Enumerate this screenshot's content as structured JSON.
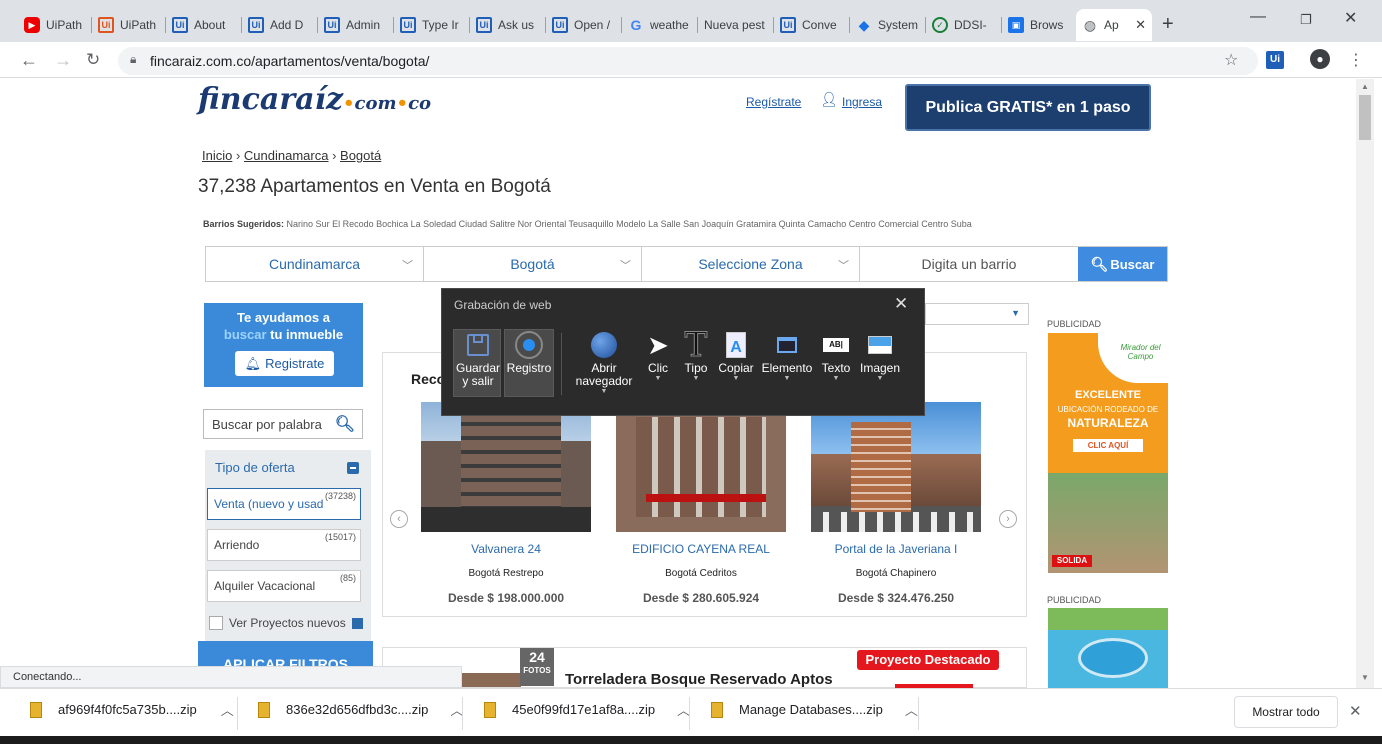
{
  "browser": {
    "tabs": [
      {
        "icon": "youtube-icon",
        "label": "UiPath"
      },
      {
        "icon": "uipath-icon",
        "label": "UiPath"
      },
      {
        "icon": "uipath-icon",
        "label": "About"
      },
      {
        "icon": "uipath-icon",
        "label": "Add D"
      },
      {
        "icon": "uipath-icon",
        "label": "Admin"
      },
      {
        "icon": "uipath-icon",
        "label": "Type Ir"
      },
      {
        "icon": "uipath-icon",
        "label": "Ask us"
      },
      {
        "icon": "uipath-icon",
        "label": "Open /"
      },
      {
        "icon": "google-icon",
        "label": "weathe"
      },
      {
        "icon": "",
        "label": "Nueva pest"
      },
      {
        "icon": "uipath-icon",
        "label": "Conve"
      },
      {
        "icon": "diamond-icon",
        "label": "System"
      },
      {
        "icon": "check-circle-icon",
        "label": "DDSI-"
      },
      {
        "icon": "box-icon",
        "label": "Brows"
      },
      {
        "icon": "globe-icon",
        "label": "Ap"
      }
    ],
    "url": "fincaraiz.com.co/apartamentos/venta/bogota/",
    "status": "Conectando..."
  },
  "header": {
    "logo_main": "fincaraíz",
    "logo_dom": "com",
    "logo_tld": "co",
    "register_link": "Regístrate",
    "login_link": "Ingresa",
    "publish_button": "Publica GRATIS* en 1 paso"
  },
  "breadcrumb": [
    "Inicio",
    "Cundinamarca",
    "Bogotá"
  ],
  "page_title": "37,238 Apartamentos en Venta en Bogotá",
  "barrios": {
    "label": "Barrios Sugeridos:",
    "items": "Narino Sur   El Recodo   Bochica   La Soledad   Ciudad Salitre Nor Oriental Teusaquillo   Modelo   La Salle   San Joaquín   Gratamira   Quinta Camacho   Centro Comercial Centro Suba"
  },
  "filters": {
    "department": "Cundinamarca",
    "city": "Bogotá",
    "zone": "Seleccione Zona",
    "neighborhood_placeholder": "Digita un barrio",
    "search_button": "Buscar"
  },
  "sidebar": {
    "help_line1": "Te ayudamos a",
    "help_highlight": "buscar",
    "help_line2": " tu inmueble",
    "register_button": "Registrate",
    "keyword_placeholder": "Buscar por palabra",
    "offer_header": "Tipo de oferta",
    "offers": [
      {
        "label": "Venta (nuevo y usad",
        "count": "(37238)"
      },
      {
        "label": "Arriendo",
        "count": "(15017)"
      },
      {
        "label": "Alquiler Vacacional",
        "count": "(85)"
      }
    ],
    "projects_checkbox": "Ver Proyectos nuevos",
    "apply_button": "APLICAR FILTROS"
  },
  "carousel": {
    "title": "Reco",
    "cards": [
      {
        "name": "Valvanera 24",
        "location": "Bogotá Restrepo",
        "price": "Desde $ 198.000.000"
      },
      {
        "name": "EDIFICIO CAYENA REAL",
        "location": "Bogotá Cedritos",
        "price": "Desde $ 280.605.924"
      },
      {
        "name": "Portal de la Javeriana I",
        "location": "Bogotá Chapinero",
        "price": "Desde $ 324.476.250"
      }
    ]
  },
  "ads": {
    "label": "PUBLICIDAD",
    "ad1_brand": "Mirador del Campo",
    "ad1_headline": "EXCELENTE",
    "ad1_sub": "UBICACIÓN RODEADO DE",
    "ad1_big": "NATURALEZA",
    "ad1_cta": "CLIC AQUÍ",
    "ad1_footer": "SOLIDA"
  },
  "listing": {
    "photos_count": "24",
    "photos_label": "FOTOS",
    "badge": "Proyecto Destacado",
    "title": "Torreladera Bosque Reservado Aptos"
  },
  "recorder": {
    "title": "Grabación de web",
    "tools": [
      {
        "id": "guardar",
        "label": "Guardar y salir"
      },
      {
        "id": "registro",
        "label": "Registro"
      },
      {
        "id": "abrir",
        "label": "Abrir navegador"
      },
      {
        "id": "clic",
        "label": "Clic"
      },
      {
        "id": "tipo",
        "label": "Tipo"
      },
      {
        "id": "copiar",
        "label": "Copiar"
      },
      {
        "id": "elemento",
        "label": "Elemento"
      },
      {
        "id": "texto",
        "label": "Texto"
      },
      {
        "id": "imagen",
        "label": "Imagen"
      }
    ]
  },
  "downloads": {
    "items": [
      "af969f4f0fc5a735b....zip",
      "836e32d656dfbd3c....zip",
      "45e0f99fd17e1af8a....zip",
      "Manage Databases....zip"
    ],
    "show_all": "Mostrar todo"
  },
  "colors": {
    "brand_navy": "#1c3f70",
    "link_blue": "#2a6aad",
    "accent_orange": "#f39200",
    "badge_red": "#e3171d"
  }
}
